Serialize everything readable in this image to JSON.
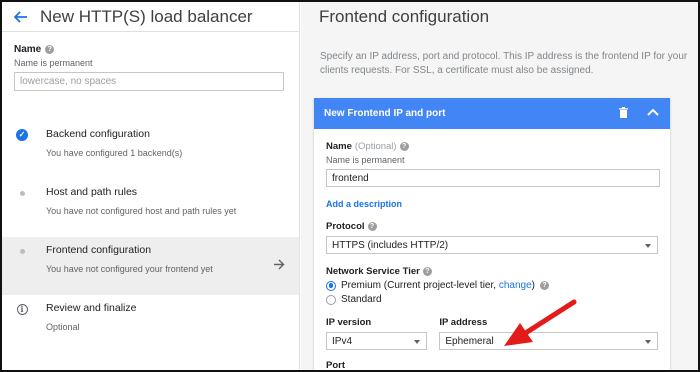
{
  "left": {
    "title": "New HTTP(S) load balancer",
    "name_label": "Name",
    "name_sub": "Name is permanent",
    "name_placeholder": "lowercase, no spaces",
    "steps": [
      {
        "title": "Backend configuration",
        "sub": "You have configured 1 backend(s)",
        "status": "done"
      },
      {
        "title": "Host and path rules",
        "sub": "You have not configured host and path rules yet",
        "status": "pending"
      },
      {
        "title": "Frontend configuration",
        "sub": "You have not configured your frontend yet",
        "status": "active"
      },
      {
        "title": "Review and finalize",
        "sub": "Optional",
        "status": "info"
      }
    ]
  },
  "right": {
    "title": "Frontend configuration",
    "description": "Specify an IP address, port and protocol. This IP address is the frontend IP for your clients requests. For SSL, a certificate must also be assigned.",
    "card": {
      "header": "New Frontend IP and port",
      "name_label": "Name",
      "name_optional": "(Optional)",
      "name_sub": "Name is permanent",
      "name_value": "frontend",
      "add_description": "Add a description",
      "protocol_label": "Protocol",
      "protocol_value": "HTTPS (includes HTTP/2)",
      "tier_label": "Network Service Tier",
      "tier_premium_text": "Premium (Current project-level tier, ",
      "tier_change_link": "change",
      "tier_premium_close": ")",
      "tier_standard": "Standard",
      "ip_version_label": "IP version",
      "ip_version_value": "IPv4",
      "ip_address_label": "IP address",
      "ip_address_value": "Ephemeral",
      "port_label": "Port"
    }
  },
  "colors": {
    "accent": "#4285f4",
    "link": "#1a73e8",
    "annotation": "#e31b1b"
  },
  "icons": [
    "back-arrow-icon",
    "help-icon",
    "check-circle-icon",
    "dot-icon",
    "info-icon",
    "arrow-right-icon",
    "trash-icon",
    "chevron-up-icon",
    "dropdown-arrow-icon",
    "annotation-arrow-icon"
  ]
}
